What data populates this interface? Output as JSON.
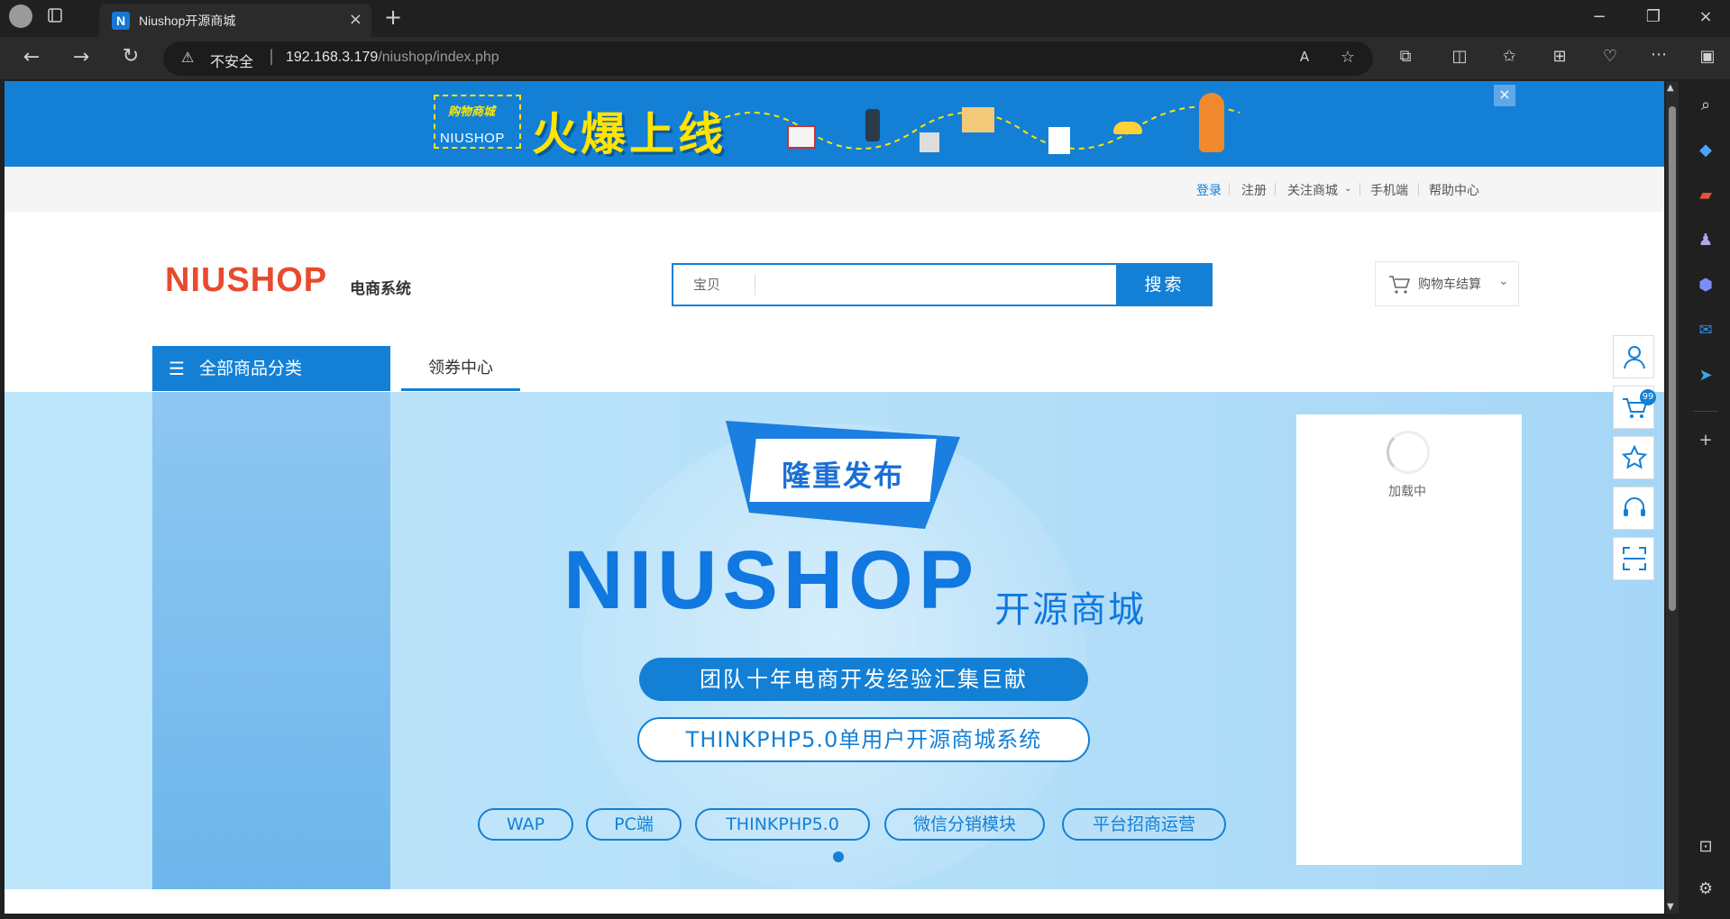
{
  "browser": {
    "tab_title": "Niushop开源商城",
    "tab_favicon": "N",
    "security_label": "不安全",
    "url_host": "192.168.3.179",
    "url_path": "/niushop/index.php"
  },
  "banner": {
    "small_text": "购物商城",
    "brand": "NIUSHOP",
    "headline": "火爆上线",
    "close": "×"
  },
  "toplinks": {
    "login": "登录",
    "register": "注册",
    "follow": "关注商城",
    "mobile": "手机端",
    "help": "帮助中心"
  },
  "header": {
    "logo_text": "NIUSHOP",
    "logo_sub": "电商系统",
    "search_category": "宝贝",
    "search_placeholder": "",
    "search_button": "搜索",
    "cart_label": "购物车结算"
  },
  "nav": {
    "category_title": "全部商品分类",
    "coupon": "领券中心"
  },
  "hero": {
    "release_tag": "隆重发布",
    "brand": "NIUSHOP",
    "brand_sub": "开源商城",
    "tagline": "团队十年电商开发经验汇集巨献",
    "subline": "THINKPHP5.0单用户开源商城系统",
    "chips": [
      "WAP",
      "PC端",
      "THINKPHP5.0",
      "微信分销模块",
      "平台招商运营"
    ]
  },
  "side": {
    "loading": "加载中",
    "cart_count": "99"
  },
  "colors": {
    "brand_blue": "#1380d6",
    "banner_yellow": "#ffe400",
    "logo_red": "#e84a2f"
  }
}
